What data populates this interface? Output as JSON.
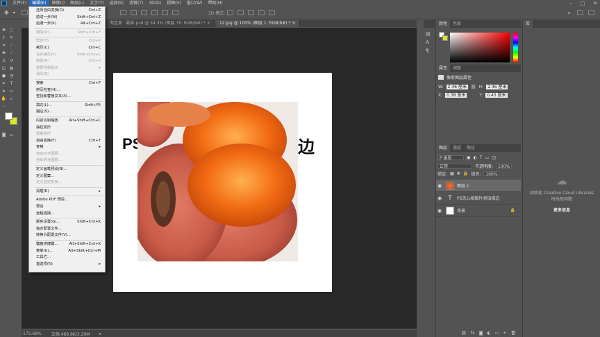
{
  "menubar": {
    "items": [
      "文件(F)",
      "编辑(E)",
      "图像(I)",
      "图层(L)",
      "文字(Y)",
      "选择(S)",
      "滤镜(T)",
      "3D(D)",
      "视图(V)",
      "窗口(W)",
      "帮助(H)"
    ],
    "active_index": 1
  },
  "options": {
    "mode_label": "3D 模式:"
  },
  "tabs": [
    {
      "label": "淘宝美 · 副本.psd @ 34.3% (图层 76, RGB/8#) *",
      "active": false
    },
    {
      "label": "12.jpg @ 100% (图层 1, RGB/8#) *",
      "active": true
    }
  ],
  "canvas": {
    "headline_left": "PS",
    "headline_right": "边"
  },
  "status": {
    "zoom": "175.69%",
    "doc": "文档:468.8K/3.29M"
  },
  "edit_menu": [
    {
      "label": "还原自由变换(O)",
      "shortcut": "Ctrl+Z",
      "disabled": false
    },
    {
      "label": "前进一步(W)",
      "shortcut": "Shift+Ctrl+Z",
      "disabled": false
    },
    {
      "label": "后退一步(K)",
      "shortcut": "Alt+Ctrl+Z",
      "disabled": false
    },
    {
      "sep": true
    },
    {
      "label": "渐隐(D)...",
      "shortcut": "Shift+Ctrl+F",
      "disabled": true
    },
    {
      "sep": true
    },
    {
      "label": "剪切(T)",
      "shortcut": "Ctrl+X",
      "disabled": true
    },
    {
      "label": "拷贝(C)",
      "shortcut": "Ctrl+C",
      "disabled": false
    },
    {
      "label": "合并拷贝(Y)",
      "shortcut": "Shift+Ctrl+C",
      "disabled": true
    },
    {
      "label": "粘贴(P)",
      "shortcut": "Ctrl+V",
      "disabled": true
    },
    {
      "label": "选择性粘贴(I)",
      "shortcut": "▸",
      "disabled": true
    },
    {
      "label": "清除(E)",
      "shortcut": "",
      "disabled": true
    },
    {
      "sep": true
    },
    {
      "label": "搜索",
      "shortcut": "Ctrl+F",
      "disabled": false
    },
    {
      "label": "拼写检查(H)...",
      "shortcut": "",
      "disabled": false
    },
    {
      "label": "查找和替换文本(X)...",
      "shortcut": "",
      "disabled": false
    },
    {
      "sep": true
    },
    {
      "label": "填充(L)...",
      "shortcut": "Shift+F5",
      "disabled": false
    },
    {
      "label": "描边(S)...",
      "shortcut": "",
      "disabled": false
    },
    {
      "sep": true
    },
    {
      "label": "内容识别缩放",
      "shortcut": "Alt+Shift+Ctrl+C",
      "disabled": false
    },
    {
      "label": "操控变形",
      "shortcut": "",
      "disabled": false
    },
    {
      "label": "透视变形",
      "shortcut": "",
      "disabled": true
    },
    {
      "label": "自由变换(F)",
      "shortcut": "Ctrl+T",
      "disabled": false
    },
    {
      "label": "变换",
      "shortcut": "▸",
      "disabled": false
    },
    {
      "label": "自动对齐图层...",
      "shortcut": "",
      "disabled": true
    },
    {
      "label": "自动混合图层...",
      "shortcut": "",
      "disabled": true
    },
    {
      "sep": true
    },
    {
      "label": "定义画笔预设(B)...",
      "shortcut": "",
      "disabled": false
    },
    {
      "label": "定义图案...",
      "shortcut": "",
      "disabled": false
    },
    {
      "label": "定义自定形状...",
      "shortcut": "",
      "disabled": true
    },
    {
      "sep": true
    },
    {
      "label": "清理(R)",
      "shortcut": "▸",
      "disabled": false
    },
    {
      "sep": true
    },
    {
      "label": "Adobe PDF 预设...",
      "shortcut": "",
      "disabled": false
    },
    {
      "label": "预设",
      "shortcut": "▸",
      "disabled": false
    },
    {
      "label": "远程连接...",
      "shortcut": "",
      "disabled": false
    },
    {
      "sep": true
    },
    {
      "label": "颜色设置(G)...",
      "shortcut": "Shift+Ctrl+K",
      "disabled": false
    },
    {
      "label": "指定配置文件...",
      "shortcut": "",
      "disabled": false
    },
    {
      "label": "转换为配置文件(V)...",
      "shortcut": "",
      "disabled": false
    },
    {
      "sep": true
    },
    {
      "label": "键盘快捷键...",
      "shortcut": "Alt+Shift+Ctrl+K",
      "disabled": false
    },
    {
      "label": "菜单(U)...",
      "shortcut": "Alt+Shift+Ctrl+M",
      "disabled": false
    },
    {
      "label": "工具栏...",
      "shortcut": "",
      "disabled": false
    },
    {
      "label": "首选项(N)",
      "shortcut": "▸",
      "disabled": false
    }
  ],
  "color_panel": {
    "tabs": [
      "颜色",
      "色板"
    ]
  },
  "properties_panel": {
    "tabs": [
      "属性",
      "调整"
    ],
    "title": "像素图层属性",
    "w_label": "W:",
    "w_value": "2.46 厘米",
    "h_label": "H:",
    "h_value": "2.46 厘米",
    "x_label": "X:",
    "x_value": "0.38 厘米",
    "y_label": "Y:",
    "y_value": "0.45 厘米"
  },
  "layers_panel": {
    "tabs": [
      "图层",
      "通道",
      "路径"
    ],
    "kind_filter": "P 类型",
    "blend_mode": "正常",
    "opacity_label": "不透明度:",
    "opacity_value": "100%",
    "lock_label": "锁定:",
    "fill_label": "填充:",
    "fill_value": "100%",
    "layers": [
      {
        "name": "图层 1",
        "selected": true,
        "kind": "image"
      },
      {
        "name": "PS怎么给图片添加描边",
        "selected": false,
        "kind": "text"
      },
      {
        "name": "背景",
        "selected": false,
        "kind": "background"
      }
    ]
  },
  "libraries_panel": {
    "tab": "库",
    "message": "初始化 Creative Cloud Libraries 时出现问题",
    "link": "更多信息"
  }
}
